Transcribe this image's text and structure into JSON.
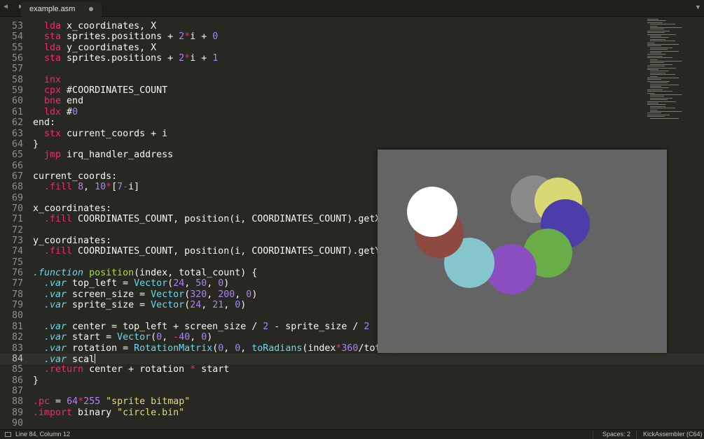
{
  "tab": {
    "title": "example.asm",
    "nav_arrows": "◀ ▶",
    "menu_icon": "▼"
  },
  "editor": {
    "lines": [
      {
        "n": "53",
        "t": [
          [
            "",
            "  "
          ],
          [
            "kw",
            "lda"
          ],
          [
            "",
            " x_coordinates, X"
          ]
        ]
      },
      {
        "n": "54",
        "t": [
          [
            "",
            "  "
          ],
          [
            "kw",
            "sta"
          ],
          [
            "",
            " sprites.positions + "
          ],
          [
            "num",
            "2"
          ],
          [
            "kw",
            "*"
          ],
          [
            "",
            "i + "
          ],
          [
            "num",
            "0"
          ]
        ]
      },
      {
        "n": "55",
        "t": [
          [
            "",
            "  "
          ],
          [
            "kw",
            "lda"
          ],
          [
            "",
            " y_coordinates, X"
          ]
        ]
      },
      {
        "n": "56",
        "t": [
          [
            "",
            "  "
          ],
          [
            "kw",
            "sta"
          ],
          [
            "",
            " sprites.positions + "
          ],
          [
            "num",
            "2"
          ],
          [
            "kw",
            "*"
          ],
          [
            "",
            "i + "
          ],
          [
            "num",
            "1"
          ]
        ]
      },
      {
        "n": "57",
        "t": []
      },
      {
        "n": "58",
        "t": [
          [
            "",
            "  "
          ],
          [
            "kw",
            "inx"
          ]
        ]
      },
      {
        "n": "59",
        "t": [
          [
            "",
            "  "
          ],
          [
            "kw",
            "cpx"
          ],
          [
            "",
            " #COORDINATES_COUNT"
          ]
        ]
      },
      {
        "n": "60",
        "t": [
          [
            "",
            "  "
          ],
          [
            "kw",
            "bne"
          ],
          [
            "",
            " end"
          ]
        ]
      },
      {
        "n": "61",
        "t": [
          [
            "",
            "  "
          ],
          [
            "kw",
            "ldx"
          ],
          [
            "",
            " #"
          ],
          [
            "num",
            "0"
          ]
        ]
      },
      {
        "n": "62",
        "t": [
          [
            "",
            "end:"
          ]
        ]
      },
      {
        "n": "63",
        "t": [
          [
            "",
            "  "
          ],
          [
            "kw",
            "stx"
          ],
          [
            "",
            " current_coords + i"
          ]
        ]
      },
      {
        "n": "64",
        "t": [
          [
            "",
            "}"
          ]
        ]
      },
      {
        "n": "65",
        "t": [
          [
            "",
            "  "
          ],
          [
            "kw",
            "jmp"
          ],
          [
            "",
            " irq_handler_address"
          ]
        ]
      },
      {
        "n": "66",
        "t": []
      },
      {
        "n": "67",
        "t": [
          [
            "",
            "current_coords:"
          ]
        ]
      },
      {
        "n": "68",
        "t": [
          [
            "",
            "  "
          ],
          [
            "kw",
            ".fill"
          ],
          [
            "",
            " "
          ],
          [
            "num",
            "8"
          ],
          [
            "",
            ", "
          ],
          [
            "num",
            "10"
          ],
          [
            "kw",
            "*"
          ],
          [
            "",
            "["
          ],
          [
            "num",
            "7"
          ],
          [
            "kw",
            "-"
          ],
          [
            "",
            "i]"
          ]
        ]
      },
      {
        "n": "69",
        "t": []
      },
      {
        "n": "70",
        "t": [
          [
            "",
            "x_coordinates:"
          ]
        ]
      },
      {
        "n": "71",
        "t": [
          [
            "",
            "  "
          ],
          [
            "kw",
            ".fill"
          ],
          [
            "",
            " COORDINATES_COUNT, position(i, COORDINATES_COUNT).getX()"
          ]
        ]
      },
      {
        "n": "72",
        "t": []
      },
      {
        "n": "73",
        "t": [
          [
            "",
            "y_coordinates:"
          ]
        ]
      },
      {
        "n": "74",
        "t": [
          [
            "",
            "  "
          ],
          [
            "kw",
            ".fill"
          ],
          [
            "",
            " COORDINATES_COUNT, position(i, COORDINATES_COUNT).getY()"
          ]
        ]
      },
      {
        "n": "75",
        "t": []
      },
      {
        "n": "76",
        "t": [
          [
            "dir",
            ".function"
          ],
          [
            "",
            " "
          ],
          [
            "fn",
            "position"
          ],
          [
            "",
            "(index, total_count) {"
          ]
        ]
      },
      {
        "n": "77",
        "t": [
          [
            "",
            "  "
          ],
          [
            "dir",
            ".var"
          ],
          [
            "",
            " top_left = "
          ],
          [
            "typ",
            "Vector"
          ],
          [
            "",
            "("
          ],
          [
            "num",
            "24"
          ],
          [
            "",
            ", "
          ],
          [
            "num",
            "50"
          ],
          [
            "",
            ", "
          ],
          [
            "num",
            "0"
          ],
          [
            "",
            ")"
          ]
        ]
      },
      {
        "n": "78",
        "t": [
          [
            "",
            "  "
          ],
          [
            "dir",
            ".var"
          ],
          [
            "",
            " screen_size = "
          ],
          [
            "typ",
            "Vector"
          ],
          [
            "",
            "("
          ],
          [
            "num",
            "320"
          ],
          [
            "",
            ", "
          ],
          [
            "num",
            "200"
          ],
          [
            "",
            ", "
          ],
          [
            "num",
            "0"
          ],
          [
            "",
            ")"
          ]
        ]
      },
      {
        "n": "79",
        "t": [
          [
            "",
            "  "
          ],
          [
            "dir",
            ".var"
          ],
          [
            "",
            " sprite_size = "
          ],
          [
            "typ",
            "Vector"
          ],
          [
            "",
            "("
          ],
          [
            "num",
            "24"
          ],
          [
            "",
            ", "
          ],
          [
            "num",
            "21"
          ],
          [
            "",
            ", "
          ],
          [
            "num",
            "0"
          ],
          [
            "",
            ")"
          ]
        ]
      },
      {
        "n": "80",
        "t": []
      },
      {
        "n": "81",
        "t": [
          [
            "",
            "  "
          ],
          [
            "dir",
            ".var"
          ],
          [
            "",
            " center = top_left + screen_size / "
          ],
          [
            "num",
            "2"
          ],
          [
            "",
            " - sprite_size / "
          ],
          [
            "num",
            "2"
          ]
        ]
      },
      {
        "n": "82",
        "t": [
          [
            "",
            "  "
          ],
          [
            "dir",
            ".var"
          ],
          [
            "",
            " start = "
          ],
          [
            "typ",
            "Vector"
          ],
          [
            "",
            "("
          ],
          [
            "num",
            "0"
          ],
          [
            "",
            ", "
          ],
          [
            "kw",
            "-"
          ],
          [
            "num",
            "40"
          ],
          [
            "",
            ", "
          ],
          [
            "num",
            "0"
          ],
          [
            "",
            ")"
          ]
        ]
      },
      {
        "n": "83",
        "t": [
          [
            "",
            "  "
          ],
          [
            "dir",
            ".var"
          ],
          [
            "",
            " rotation = "
          ],
          [
            "typ",
            "RotationMatrix"
          ],
          [
            "",
            "("
          ],
          [
            "num",
            "0"
          ],
          [
            "",
            ", "
          ],
          [
            "num",
            "0"
          ],
          [
            "",
            ", "
          ],
          [
            "typ",
            "toRadians"
          ],
          [
            "",
            "(index"
          ],
          [
            "kw",
            "*"
          ],
          [
            "num",
            "360"
          ],
          [
            "",
            "/total_count))"
          ]
        ]
      },
      {
        "n": "84",
        "t": [
          [
            "",
            "  "
          ],
          [
            "dir",
            ".var"
          ],
          [
            "",
            " scal"
          ],
          [
            "cursor",
            ""
          ]
        ],
        "current": true
      },
      {
        "n": "85",
        "t": [
          [
            "",
            "  "
          ],
          [
            "kw",
            ".return"
          ],
          [
            "",
            " center + rotation "
          ],
          [
            "kw",
            "*"
          ],
          [
            "",
            " start"
          ]
        ]
      },
      {
        "n": "86",
        "t": [
          [
            "",
            "}"
          ]
        ]
      },
      {
        "n": "87",
        "t": []
      },
      {
        "n": "88",
        "t": [
          [
            "kw",
            ".pc"
          ],
          [
            "",
            " = "
          ],
          [
            "num",
            "64"
          ],
          [
            "kw",
            "*"
          ],
          [
            "num",
            "255"
          ],
          [
            "",
            " "
          ],
          [
            "str",
            "\"sprite bitmap\""
          ]
        ]
      },
      {
        "n": "89",
        "t": [
          [
            "kw",
            ".import"
          ],
          [
            "",
            " binary "
          ],
          [
            "str",
            "\"circle.bin\""
          ]
        ]
      },
      {
        "n": "90",
        "t": []
      }
    ]
  },
  "preview": {
    "background": "#646464",
    "sprites": [
      {
        "name": "gray",
        "color": "#8a8a8a"
      },
      {
        "name": "yellow",
        "color": "#d8d874"
      },
      {
        "name": "blue",
        "color": "#4c3eaa"
      },
      {
        "name": "green",
        "color": "#6aae4a"
      },
      {
        "name": "purple",
        "color": "#8a4ec0"
      },
      {
        "name": "cyan",
        "color": "#84c6cc"
      },
      {
        "name": "red",
        "color": "#8e4a40"
      },
      {
        "name": "white",
        "color": "#ffffff"
      }
    ]
  },
  "status": {
    "position": "Line 84, Column 12",
    "spaces": "Spaces: 2",
    "syntax": "KickAssembler (C64)"
  }
}
